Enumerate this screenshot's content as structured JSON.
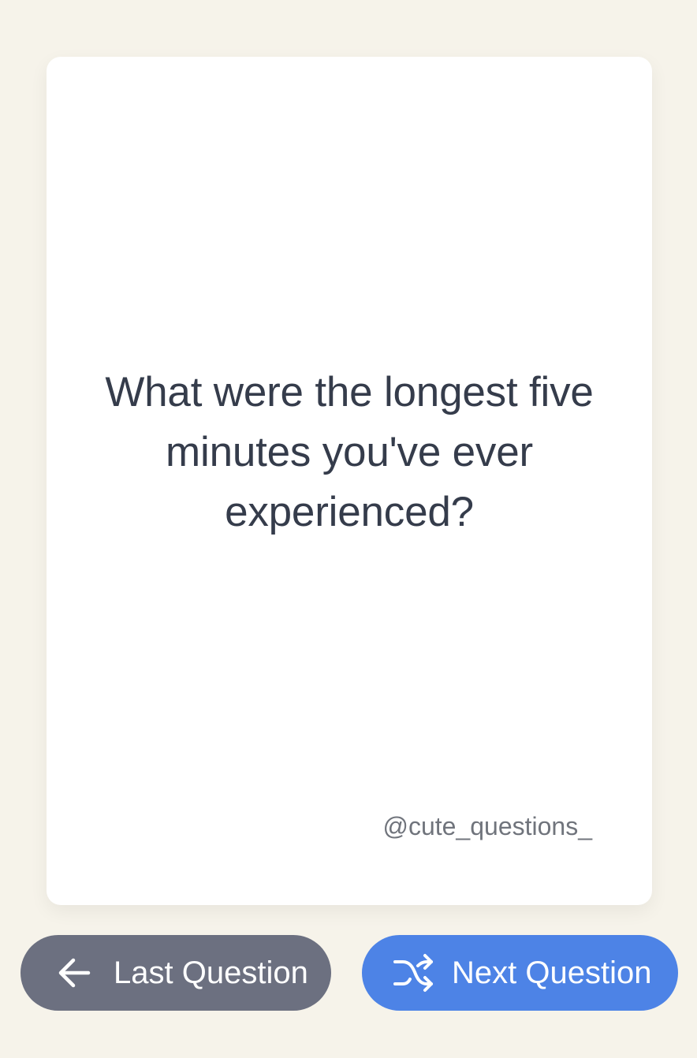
{
  "card": {
    "question": "What were the longest five minutes you've ever experienced?",
    "handle": "@cute_questions_"
  },
  "buttons": {
    "last": {
      "label": "Last Question",
      "icon": "arrow-left-icon"
    },
    "next": {
      "label": "Next Question",
      "icon": "shuffle-icon"
    }
  },
  "colors": {
    "background": "#f6f3ea",
    "card": "#ffffff",
    "text": "#353c4b",
    "handle": "#70747c",
    "last_button": "#6c7080",
    "next_button": "#4d83e6"
  }
}
